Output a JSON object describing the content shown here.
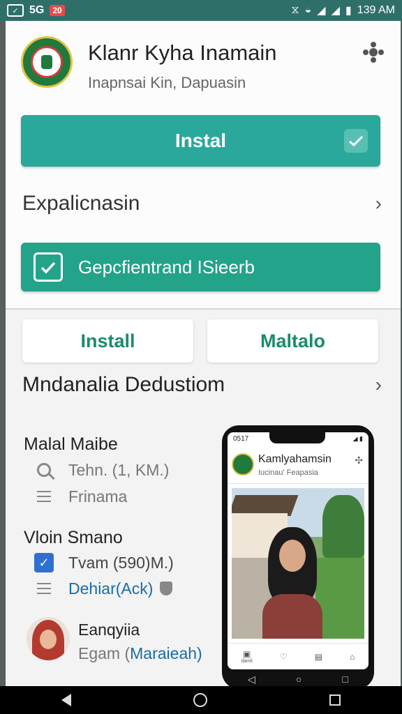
{
  "status_bar": {
    "left_icon_label": "",
    "left_text": "5G",
    "badge": "20",
    "time": "139 AM"
  },
  "app": {
    "title": "Klanr Kyha Inamain",
    "subtitle": "Inapnsai Kin, Dapuasin",
    "install_main_label": "Instal",
    "explanation_label": "Expalicnasin",
    "check_button_label": "Gepcfientrand  ISieerb",
    "install_label": "Install",
    "secondary_label": "Maltalo",
    "section_title": "Mndanalia Dedustiom"
  },
  "list": {
    "group1": {
      "heading": "Malal Maibe",
      "item1": "Tehn. (1, KM.)",
      "item2": "Frinama"
    },
    "group2": {
      "heading": "Vloin Smano",
      "item1": "Tvam (590)M.)",
      "item2": "Dehiar(Ack)"
    },
    "profile": {
      "name": "Eanqyiia",
      "sub_prefix": "Egam (",
      "sub_link": "Maraieah)"
    }
  },
  "phone_preview": {
    "time": "0517",
    "title": "Kamlyahamsin",
    "subtitle": "Iucinau' Feapasia",
    "nav_first_label": "Ilamli"
  },
  "icons": {
    "puzzle": "puzzle-icon",
    "check": "check-icon",
    "chevron": "chevron-right-icon",
    "search": "search-icon",
    "menu": "list-icon",
    "shield": "shield-icon"
  },
  "colors": {
    "primary_teal": "#2aa89b",
    "green_button": "#22a38a",
    "accent_text": "#1d8a6e",
    "link_blue": "#1a6ca8"
  }
}
